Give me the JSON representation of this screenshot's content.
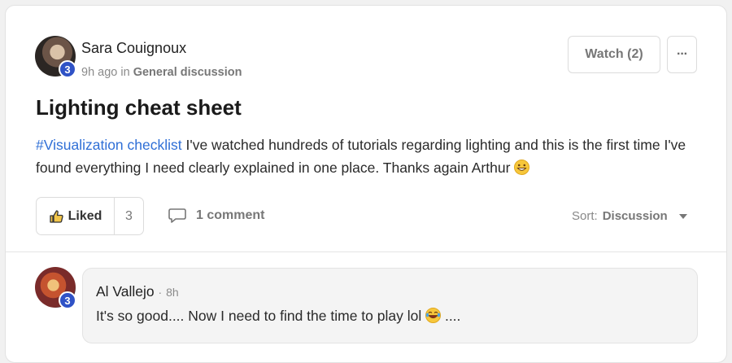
{
  "post": {
    "author_name": "Sara Couignoux",
    "author_level": "3",
    "time_ago": "9h ago",
    "in_word": "in",
    "category": "General discussion",
    "watch_label": "Watch (2)",
    "more_label": "···",
    "title": "Lighting cheat sheet",
    "hashtag": "#Visualization checklist",
    "body": " I've watched hundreds of tutorials regarding lighting and this is the first time I've found everything I need clearly explained in one place. Thanks again Arthur ",
    "emoji": "grinning-face-emoji"
  },
  "actions": {
    "liked_label": "Liked",
    "like_count": "3",
    "comment_label": "1 comment",
    "sort_prefix": "Sort:",
    "sort_value": "Discussion"
  },
  "comments": [
    {
      "author": "Al Vallejo",
      "level": "3",
      "time": "8h",
      "separator": "·",
      "text": "It's so good.... Now I need to find the time to play lol ",
      "emoji": "laughing-tears-emoji",
      "suffix": " ...."
    }
  ],
  "colors": {
    "accent": "#2f52c6",
    "hashtag": "#2f6fd6"
  }
}
